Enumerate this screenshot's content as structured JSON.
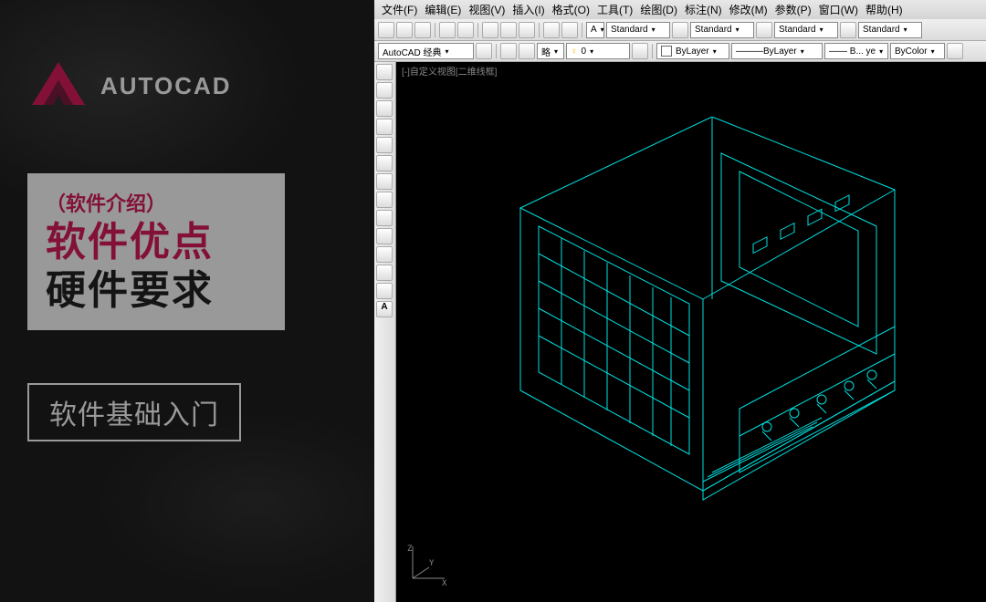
{
  "left": {
    "brand": "AUTOCAD",
    "slogan_sub": "（软件介绍）",
    "slogan_line1": "软件优点",
    "slogan_line2": "硬件要求",
    "bottom": "软件基础入门"
  },
  "menubar": [
    "文件(F)",
    "编辑(E)",
    "视图(V)",
    "插入(I)",
    "格式(O)",
    "工具(T)",
    "绘图(D)",
    "标注(N)",
    "修改(M)",
    "参数(P)",
    "窗口(W)",
    "帮助(H)"
  ],
  "toolbar1": {
    "annotate_drop": "A",
    "standard1": "Standard",
    "standard2": "Standard",
    "standard3": "Standard",
    "standard4": "Standard"
  },
  "toolbar2": {
    "workspace": "AutoCAD 经典",
    "layer_state": "略",
    "layer_drop": "0",
    "bylayer1": "ByLayer",
    "linetype": "———ByLayer",
    "weight": "—— B... ye",
    "bycolor": "ByColor"
  },
  "viewport_label": "[-]自定义视图[二维线框]",
  "axes": {
    "x": "X",
    "y": "Y",
    "z": "Z"
  },
  "colors": {
    "accent": "#da1c5c",
    "cad": "#00e0e0"
  }
}
